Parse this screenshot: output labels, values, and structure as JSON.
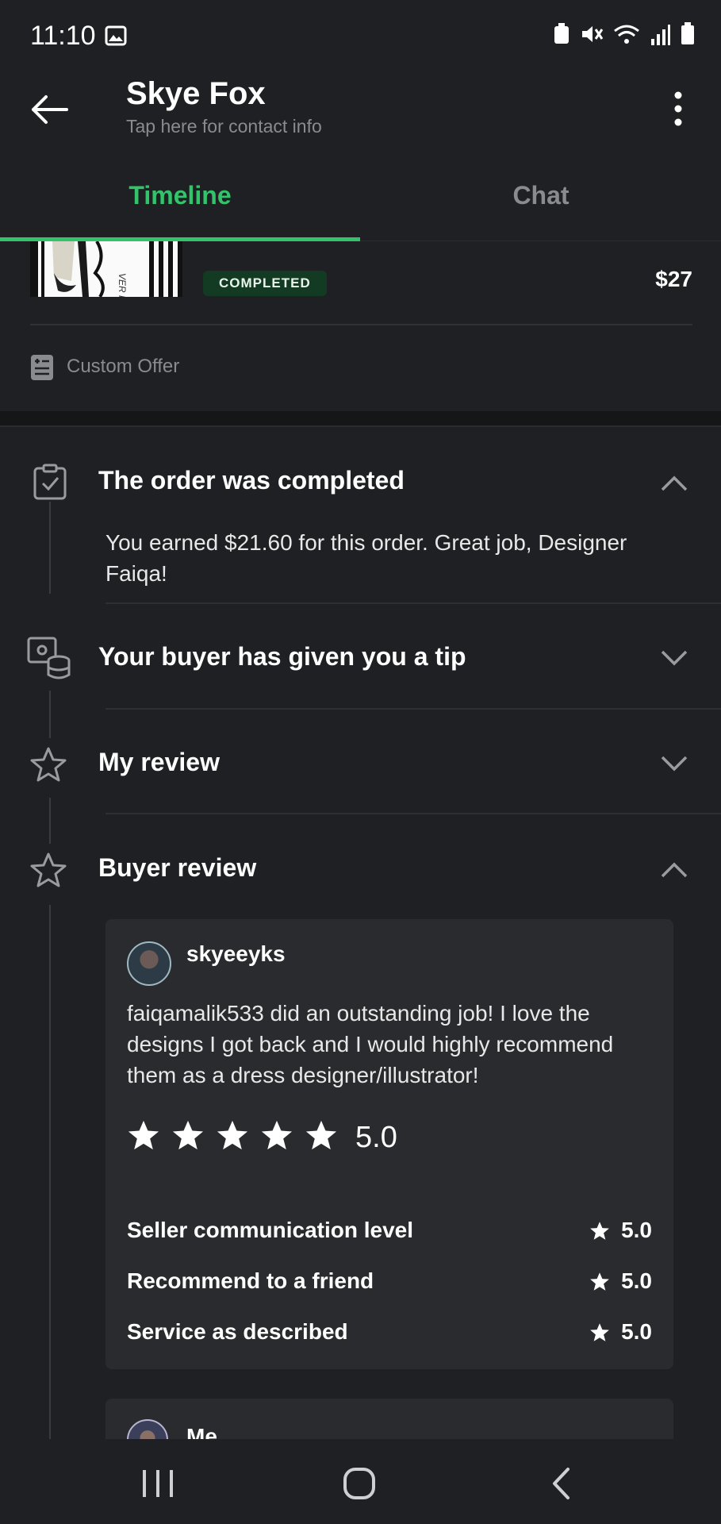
{
  "status": {
    "time": "11:10"
  },
  "header": {
    "title": "Skye Fox",
    "subtitle": "Tap here for contact info"
  },
  "tabs": [
    {
      "label": "Timeline",
      "active": true
    },
    {
      "label": "Chat",
      "active": false
    }
  ],
  "order": {
    "status_badge": "COMPLETED",
    "price": "$27",
    "offer_label": "Custom Offer"
  },
  "timeline": {
    "completed": {
      "title": "The order was completed",
      "body": "You earned $21.60 for this order. Great job, Designer Faiqa!",
      "expanded": true
    },
    "tip": {
      "title": "Your buyer has given you a tip",
      "expanded": false
    },
    "my_review": {
      "title": "My review",
      "expanded": false
    },
    "buyer_review": {
      "title": "Buyer review",
      "expanded": true
    }
  },
  "review": {
    "username": "skyeeyks",
    "text": "faiqamalik533 did an outstanding job! I love the designs I got back and I would highly recommend them as a dress designer/illustrator!",
    "rating": "5.0",
    "criteria": [
      {
        "label": "Seller communication level",
        "value": "5.0"
      },
      {
        "label": "Recommend to a friend",
        "value": "5.0"
      },
      {
        "label": "Service as described",
        "value": "5.0"
      }
    ]
  },
  "my_review_card": {
    "username": "Me"
  },
  "colors": {
    "accent": "#33c46b",
    "background": "#1f2023",
    "card": "#2a2b2e"
  }
}
